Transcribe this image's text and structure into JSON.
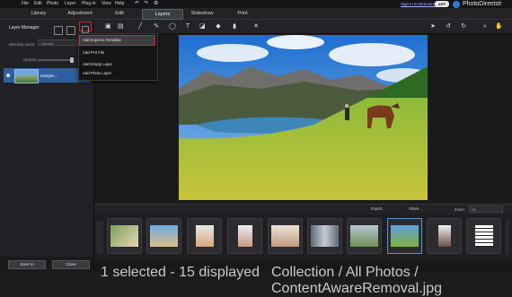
{
  "menu": {
    "items": [
      "File",
      "Edit",
      "Photo",
      "Layer",
      "Plug-in",
      "View",
      "Help"
    ],
    "sign_in": "Sign in to DirectorZone",
    "apps_badge": "APP",
    "brand": "PhotoDirector"
  },
  "tabs": [
    "Library",
    "Adjustment",
    "Edit",
    "Layers",
    "Slideshow",
    "Print"
  ],
  "active_tab": "Layers",
  "layer_manager": {
    "title": "Layer Manager",
    "blending_label": "Blending mode:",
    "blending_value": "Normal",
    "opacity_label": "Opacity:",
    "opacity_level": 0.9,
    "layer_name": "Multiple...",
    "save_button": "Save to",
    "close_button": "Close"
  },
  "add_layer_menu": {
    "items": [
      "Add Express Template",
      "Add PHI File",
      "Add Empty Layer",
      "Add Photo Layer"
    ],
    "highlighted": "Add Express Template"
  },
  "browser": {
    "export_label": "Export...",
    "share_label": "Share...",
    "zoom_label": "Zoom:",
    "zoom_value": "Fit",
    "thumbnail_count": 11,
    "selected_index": 8
  },
  "status": {
    "selection": "1 selected - 15 displayed",
    "path": "Collection / All Photos / ContentAwareRemoval.jpg"
  },
  "colors": {
    "accent_blue": "#2f5fa0",
    "highlight_red": "#d42632",
    "background": "#1c1c1e"
  }
}
